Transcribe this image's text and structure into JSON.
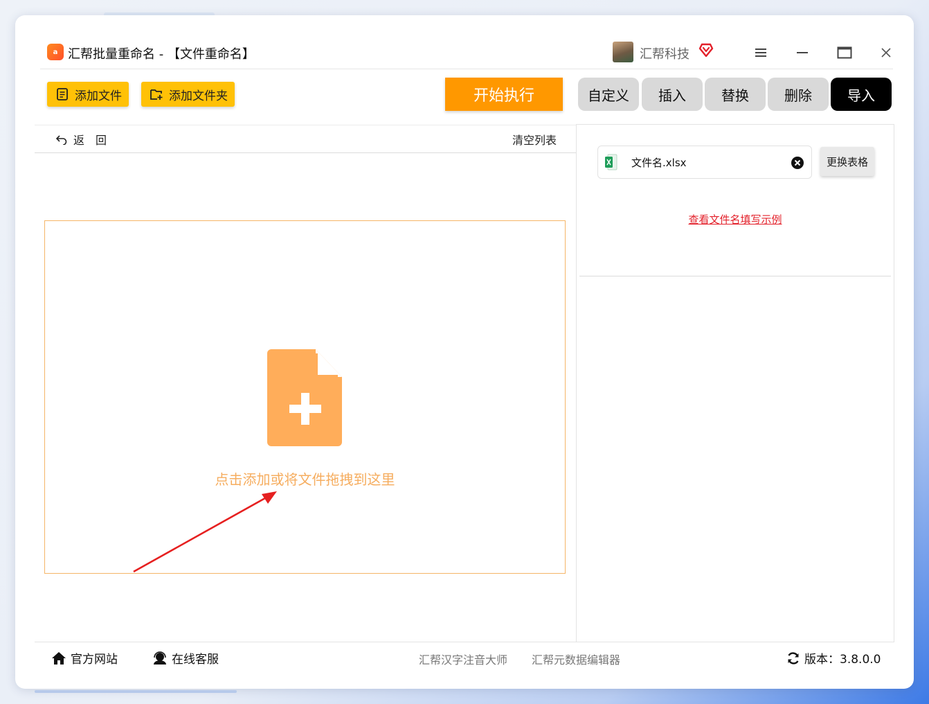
{
  "window": {
    "app_title": "汇帮批量重命名 - 【文件重命名】",
    "app_icon_text": "a",
    "user_name": "汇帮科技"
  },
  "icons": {
    "app": "app-logo-icon",
    "vip": "vip-heart-icon",
    "menu": "menu-icon",
    "minimize": "minimize-icon",
    "maximize": "maximize-icon",
    "close": "close-icon",
    "add_file": "add-file-icon",
    "add_folder": "add-folder-icon",
    "back": "back-arrow-icon",
    "excel": "excel-icon",
    "remove": "remove-circle-icon",
    "home": "home-icon",
    "support": "support-icon",
    "refresh": "refresh-icon"
  },
  "toolbar": {
    "add_file_label": "添加文件",
    "add_folder_label": "添加文件夹",
    "start_label": "开始执行"
  },
  "tabs": [
    {
      "label": "自定义",
      "active": false
    },
    {
      "label": "插入",
      "active": false
    },
    {
      "label": "替换",
      "active": false
    },
    {
      "label": "删除",
      "active": false
    },
    {
      "label": "导入",
      "active": true
    }
  ],
  "list_header": {
    "back_label": "返　回",
    "clear_label": "清空列表"
  },
  "drop_zone": {
    "hint": "点击添加或将文件拖拽到这里"
  },
  "import_panel": {
    "file_name": "文件名.xlsx",
    "swap_label": "更换表格",
    "example_link": "查看文件名填写示例"
  },
  "footer": {
    "website": "官方网站",
    "support": "在线客服",
    "link_pinyin": "汇帮汉字注音大师",
    "link_meta": "汇帮元数据编辑器",
    "version": "版本：3.8.0.0"
  },
  "colors": {
    "toolbar_button": "#ffc107",
    "start_button": "#ff9800",
    "drop_border": "#f5b567",
    "drop_text": "#f6ad5f",
    "file_icon": "#ffad5a",
    "active_tab": "#000000",
    "tab": "#d9d9d9",
    "link_red": "#e3202a",
    "arrow_red": "#e62020"
  }
}
